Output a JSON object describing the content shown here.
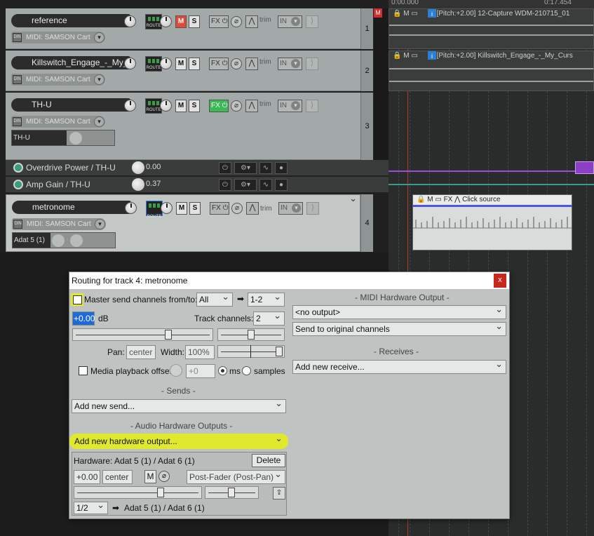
{
  "tracks": [
    {
      "num": "1",
      "name": "reference",
      "midi": "MIDI: SAMSON Cart",
      "mute_on": true,
      "fx_on": false
    },
    {
      "num": "2",
      "name": "Killswitch_Engage_-_My_",
      "midi": "MIDI: SAMSON Cart",
      "mute_on": false,
      "fx_on": false
    },
    {
      "num": "3",
      "name": "TH-U",
      "midi": "MIDI: SAMSON Cart",
      "fx_param": "TH-U",
      "mute_on": false,
      "fx_on": true
    },
    {
      "num": "4",
      "name": "metronome",
      "midi": "MIDI: SAMSON Cart",
      "fx_param": "Adat 5 (1)",
      "mute_on": false,
      "fx_on": false
    }
  ],
  "labels": {
    "route": "ROUTE",
    "m": "M",
    "s": "S",
    "fx": "FX",
    "trim": "trim",
    "in": "IN",
    "record_marker": "M"
  },
  "envelopes": [
    {
      "name": "Overdrive Power / TH-U",
      "value": "0.00"
    },
    {
      "name": "Amp Gain / TH-U",
      "value": "0.37"
    }
  ],
  "arrange": {
    "ruler_start": "0:00.000",
    "ruler_mark": "0:17.454",
    "item1": "[Pitch:+2.00] 12-Capture WDM-210715_01",
    "item2": "[Pitch:+2.00] Killswitch_Engage_-_My_Curs",
    "click_item": "Click source"
  },
  "dialog": {
    "title": "Routing for track 4: metronome",
    "close": "x",
    "master_send_label": "Master send channels from/to:",
    "master_from": "All",
    "master_to": "1-2",
    "volume": "+0.00",
    "db": "dB",
    "track_channels_label": "Track channels:",
    "track_channels": "2",
    "pan_label": "Pan:",
    "pan": "center",
    "width_label": "Width:",
    "width": "100%",
    "media_offset_label": "Media playback offset:",
    "media_offset": "+0",
    "ms": "ms",
    "samples": "samples",
    "sends_header": "- Sends -",
    "add_send": "Add new send...",
    "audio_hw_header": "- Audio Hardware Outputs -",
    "add_hw": "Add new hardware output...",
    "hw_label": "Hardware: Adat 5 (1) / Adat 6 (1)",
    "delete": "Delete",
    "hw_vol": "+0.00",
    "hw_pan": "center",
    "hw_m": "M",
    "hw_mode": "Post-Fader (Post-Pan)",
    "hw_channels": "1/2",
    "hw_dest": "Adat 5 (1) / Adat 6 (1)",
    "midi_hw_header": "- MIDI Hardware Output -",
    "midi_out": "<no output>",
    "midi_channels": "Send to original channels",
    "receives_header": "- Receives -",
    "add_receive": "Add new receive..."
  },
  "colors": {
    "highlight": "#e6f014",
    "mute_on": "#e24a38",
    "fx_on": "#3bb955"
  }
}
